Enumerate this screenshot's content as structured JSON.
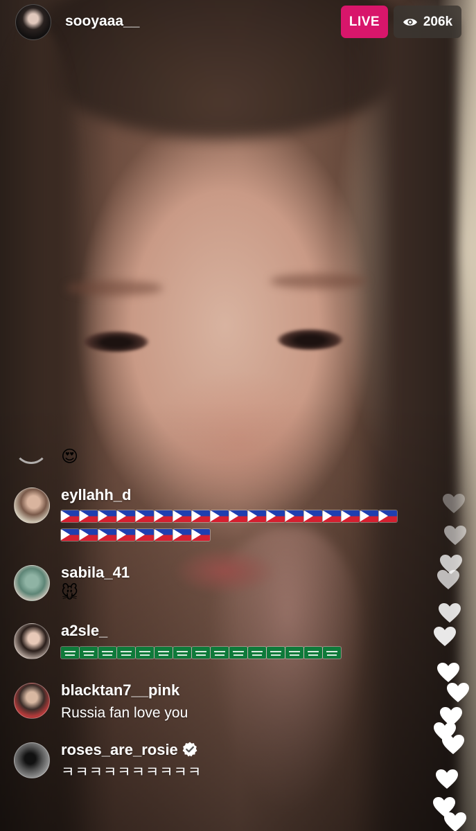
{
  "stream": {
    "host_username": "sooyaaa__",
    "live_label": "LIVE",
    "viewer_count": "206k",
    "live_color": "#d8166b"
  },
  "comments_top": {
    "emoji": "😍"
  },
  "comments": [
    {
      "username": "eyllahh_d",
      "message": "",
      "flag": "philippines",
      "flag_rows": [
        18,
        8
      ]
    },
    {
      "username": "sabila_41",
      "message": "🐭"
    },
    {
      "username": "a2sle_",
      "message": "",
      "flag": "saudi-arabia",
      "flag_rows": [
        15
      ]
    },
    {
      "username": "blacktan7__pink",
      "message": "Russia fan love you"
    },
    {
      "username": "roses_are_rosie",
      "message": "ㅋㅋㅋㅋㅋㅋㅋㅋㅋㅋ",
      "verified": true
    }
  ],
  "icons": {
    "viewers": "eye-icon",
    "verified": "verified-badge-icon",
    "reaction": "heart-icon"
  }
}
